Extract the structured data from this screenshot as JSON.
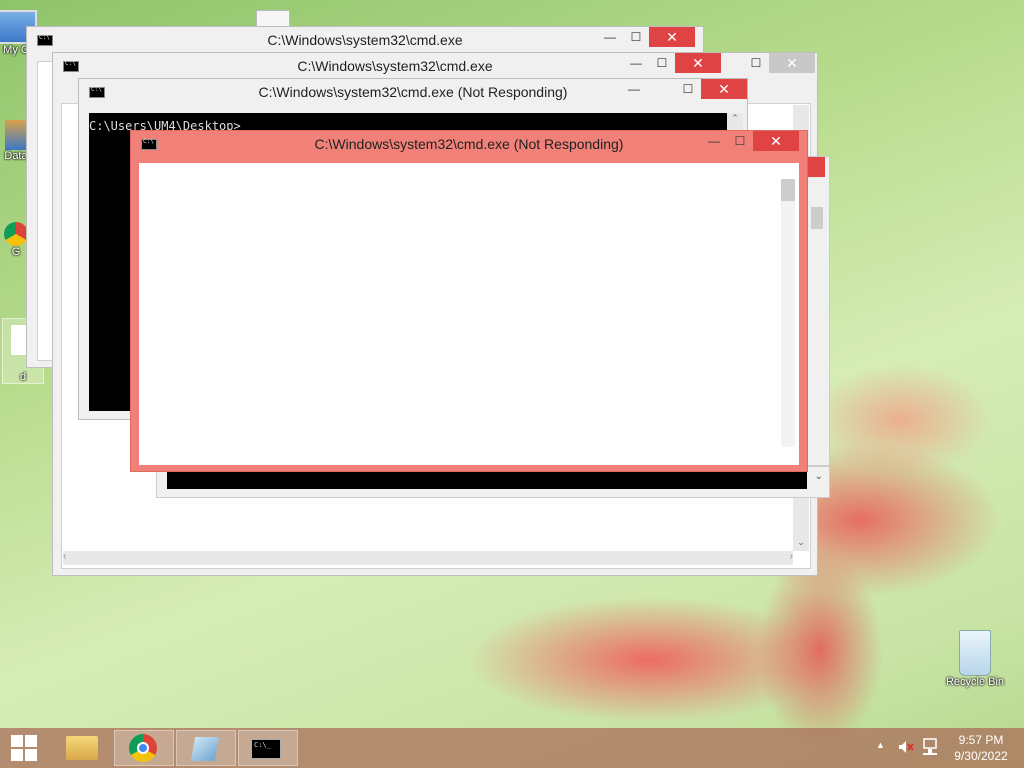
{
  "desktop": {
    "icons": [
      {
        "label": "My C"
      },
      {
        "label": "Data"
      },
      {
        "label": "G"
      },
      {
        "label": "d"
      },
      {
        "label": "Recycle Bin"
      }
    ]
  },
  "windows": {
    "back": {
      "title": "C:\\Windows\\system32\\cmd.exe",
      "minimize": "—",
      "maximize": "☐",
      "close": "✕"
    },
    "middle": {
      "title": "C:\\Windows\\system32\\cmd.exe",
      "minimize": "—",
      "maximize": "☐",
      "close": "✕"
    },
    "front_dark": {
      "title": "C:\\Windows\\system32\\cmd.exe (Not Responding)",
      "prompt": "C:\\Users\\UM4\\Desktop>",
      "minimize": "—",
      "maximize": "☐",
      "close": "✕"
    },
    "front_red": {
      "title": "C:\\Windows\\system32\\cmd.exe (Not Responding)",
      "minimize": "—",
      "maximize": "☐",
      "close": "✕"
    }
  },
  "taskbar": {
    "items": [
      {
        "name": "start-button",
        "icon": "windows-logo-icon"
      },
      {
        "name": "file-explorer",
        "icon": "folder-icon"
      },
      {
        "name": "chrome",
        "icon": "chrome-icon"
      },
      {
        "name": "notepad",
        "icon": "notepad-icon"
      },
      {
        "name": "cmd",
        "icon": "cmd-icon"
      }
    ],
    "clock": {
      "time": "9:57 PM",
      "date": "9/30/2022"
    },
    "tray_arrow": "▲"
  },
  "colors": {
    "close_red": "#e04343",
    "not_responding_frame": "#f08078",
    "taskbar": "#aa6e5a"
  }
}
